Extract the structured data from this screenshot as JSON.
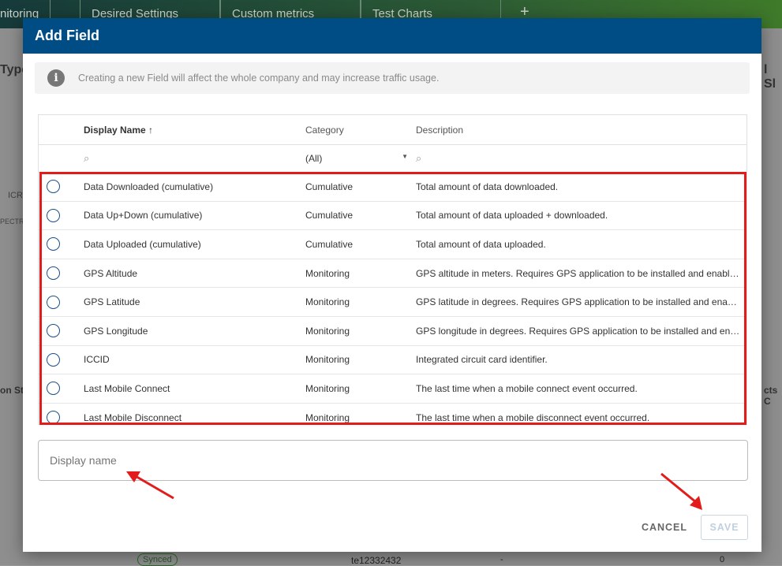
{
  "background": {
    "tabs": [
      "nitoring",
      "Desired Settings",
      "Custom metrics",
      "Test Charts"
    ],
    "add_tab": "+",
    "fragments": {
      "left_title": "Type",
      "right_title": "l Sl",
      "left_col": "on St",
      "right_col": "cts C",
      "left_small1": "ICR",
      "left_small2": "PECTR",
      "badge": "Synced",
      "cell_id": "te12332432",
      "cell_dash": "-",
      "cell_zero": "0"
    }
  },
  "modal": {
    "title": "Add Field",
    "info": "Creating a new Field will affect the whole company and may increase traffic usage.",
    "columns": {
      "name": "Display Name",
      "sort_indicator": "↑",
      "category": "Category",
      "description": "Description"
    },
    "filter": {
      "category": "(All)"
    },
    "rows": [
      {
        "name": "Data Downloaded (cumulative)",
        "category": "Cumulative",
        "description": "Total amount of data downloaded."
      },
      {
        "name": "Data Up+Down (cumulative)",
        "category": "Cumulative",
        "description": "Total amount of data uploaded + downloaded."
      },
      {
        "name": "Data Uploaded (cumulative)",
        "category": "Cumulative",
        "description": "Total amount of data uploaded."
      },
      {
        "name": "GPS Altitude",
        "category": "Monitoring",
        "description": "GPS altitude in meters. Requires GPS application to be installed and enabled."
      },
      {
        "name": "GPS Latitude",
        "category": "Monitoring",
        "description": "GPS latitude in degrees. Requires GPS application to be installed and enabled."
      },
      {
        "name": "GPS Longitude",
        "category": "Monitoring",
        "description": "GPS longitude in degrees. Requires GPS application to be installed and enabled."
      },
      {
        "name": "ICCID",
        "category": "Monitoring",
        "description": "Integrated circuit card identifier."
      },
      {
        "name": "Last Mobile Connect",
        "category": "Monitoring",
        "description": "The last time when a mobile connect event occurred."
      },
      {
        "name": "Last Mobile Disconnect",
        "category": "Monitoring",
        "description": "The last time when a mobile disconnect event occurred."
      }
    ],
    "display_name_placeholder": "Display name",
    "cancel": "CANCEL",
    "save": "SAVE"
  },
  "colors": {
    "header": "#004d86",
    "highlight": "#e31b1b"
  }
}
